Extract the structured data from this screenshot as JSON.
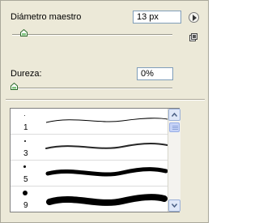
{
  "brush_panel": {
    "diameter": {
      "label": "Diámetro maestro",
      "value": "13 px",
      "slider_fraction": 0.05
    },
    "hardness": {
      "label": "Dureza:",
      "value": "0%",
      "slider_fraction": 0.0
    },
    "menu_button_icon": "right-arrow-icon",
    "new_preset_icon": "new-preset-icon",
    "presets": [
      {
        "size": "1"
      },
      {
        "size": "3"
      },
      {
        "size": "5"
      },
      {
        "size": "9"
      }
    ],
    "scrollbar": {
      "up_icon": "chevron-up-icon",
      "down_icon": "chevron-down-icon"
    }
  }
}
